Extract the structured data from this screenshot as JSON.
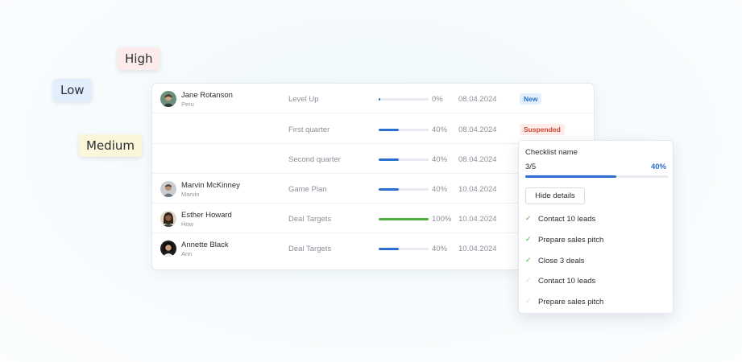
{
  "priority_tags": {
    "high": "High",
    "low": "Low",
    "medium": "Medium"
  },
  "rows": [
    {
      "name": "Jane Rotanson",
      "sub": "Peru",
      "task": "Level Up",
      "progress": 0.03,
      "pct": "0%",
      "date": "08.04.2024",
      "status": "New"
    },
    {
      "name": "",
      "sub": "",
      "task": "First quarter",
      "progress": 0.4,
      "pct": "40%",
      "date": "08.04.2024",
      "status": "Suspended"
    },
    {
      "name": "",
      "sub": "",
      "task": "Second quarter",
      "progress": 0.4,
      "pct": "40%",
      "date": "08.04.2024",
      "status": ""
    },
    {
      "name": "Marvin McKinney",
      "sub": "Marvin",
      "task": "Game Plan",
      "progress": 0.4,
      "pct": "40%",
      "date": "10.04.2024",
      "status": ""
    },
    {
      "name": "Esther Howard",
      "sub": "How",
      "task": "Deal Targets",
      "progress": 1.0,
      "pct": "100%",
      "date": "10.04.2024",
      "status": ""
    },
    {
      "name": "Annette Black",
      "sub": "Ann",
      "task": "Deal Targets",
      "progress": 0.4,
      "pct": "40%",
      "date": "10.04.2024",
      "status": ""
    }
  ],
  "checklist": {
    "title": "Checklist name",
    "count": "3/5",
    "pct": "40%",
    "progress": 0.64,
    "button": "Hide details",
    "items": [
      {
        "label": "Contact 10 leads",
        "checked": true
      },
      {
        "label": "Prepare sales pitch",
        "checked": true
      },
      {
        "label": "Close 3 deals",
        "checked": true
      },
      {
        "label": "Contact 10 leads",
        "checked": false
      },
      {
        "label": "Prepare sales pitch",
        "checked": false
      }
    ]
  },
  "colors": {
    "accent": "#2c6fd0",
    "success": "#4caf3d",
    "new_badge": "#2a6fc9",
    "suspended_badge": "#d2452f"
  }
}
